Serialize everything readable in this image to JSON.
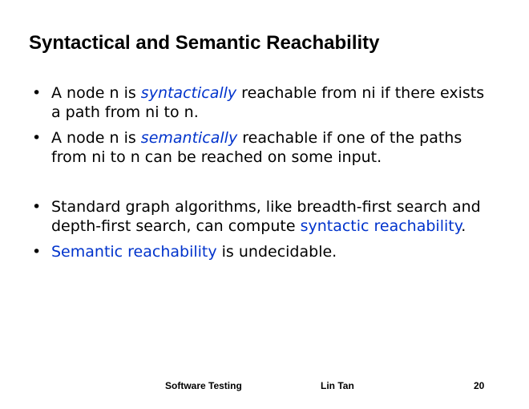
{
  "slide": {
    "title": "Syntactical and Semantic Reachability",
    "bullet_symbol": "•",
    "bullets": [
      {
        "pre": "A node n is ",
        "emph": "syntactically",
        "post": " reachable from ni if there exists a path from ni to n."
      },
      {
        "pre": "A node n is ",
        "emph": "semantically",
        "post": " reachable if one of the paths from ni to n can be reached on some input."
      },
      {
        "pre": "Standard graph algorithms, like breadth-first search and depth-first search, can compute ",
        "emph": "syntactic reachability",
        "post": "."
      },
      {
        "pre": "",
        "emph": "Semantic reachability",
        "post": " is undecidable."
      }
    ]
  },
  "footer": {
    "course": "Software Testing",
    "author": "Lin Tan",
    "page_number": "20"
  },
  "colors": {
    "emphasis": "#0033cc"
  }
}
